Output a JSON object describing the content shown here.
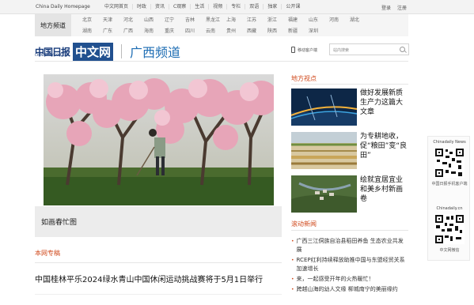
{
  "topbar": {
    "brand": "China Daily Homepage",
    "nav": [
      "中文网首页",
      "时政",
      "资讯",
      "C观察",
      "生活",
      "视频",
      "专栏",
      "双语",
      "独家",
      "公开课"
    ],
    "login": "登录",
    "register": "注册"
  },
  "regions": {
    "label": "地方频道",
    "row1": [
      "北京",
      "天津",
      "河北",
      "山西",
      "辽宁",
      "吉林",
      "黑龙江",
      "上海",
      "江苏",
      "浙江",
      "福建",
      "山东",
      "河南",
      "湖北"
    ],
    "row2": [
      "湖南",
      "广东",
      "广西",
      "海南",
      "重庆",
      "四川",
      "云南",
      "贵州",
      "西藏",
      "陕西",
      "新疆",
      "深圳"
    ]
  },
  "header": {
    "logo_cn": "中国日报",
    "logo_sub": "CHINADAILY.COM.CN",
    "logo_zw": "中文网",
    "channel": "广西频道",
    "mobile": "移动客户端",
    "search_placeholder": "站内搜索"
  },
  "hero": {
    "caption": "如画春忙图"
  },
  "columns": {
    "title": "本网专稿",
    "headline": "中国桂林平乐2024绿水青山中国休闲运动挑战赛将于5月1日举行"
  },
  "right": {
    "local_head": "地方视点",
    "features": [
      {
        "title": "做好发展新质生产力这篇大文章"
      },
      {
        "title": "为专耕地收，促“粮田”变“良田”"
      },
      {
        "title": "绘就宜居宜业和美乡村新画卷"
      }
    ],
    "scroll_head": "滚动新闻",
    "scroll_items": [
      "广西三江侗族自治县稻田养鱼 生态农业共发展",
      "RCEP红利持续释放助推中国与东盟经贸关系加速增长",
      "来，一起感受开年的火热暖忙！",
      "跨越山海的幼人文缘 柳城南宁的美丽缘约"
    ]
  },
  "qr": {
    "title1": "Chinadaily News",
    "cap1": "中国日报手机客户端",
    "title2": "Chinadaily.cn",
    "cap2": "中文网微信"
  },
  "colors": {
    "accent": "#d04a1d",
    "brand_blue": "#21508f",
    "channel_blue": "#1c6cb3"
  }
}
